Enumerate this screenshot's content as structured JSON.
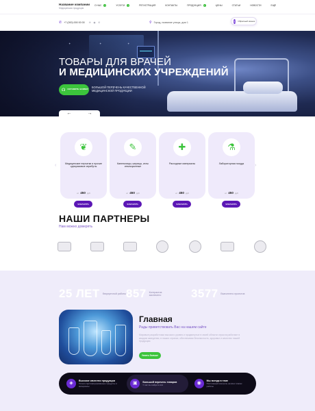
{
  "header": {
    "company_name": "Название компании",
    "company_sub": "Медицинская продукция",
    "nav": [
      {
        "label": "О нас",
        "plus": true
      },
      {
        "label": "Услуги",
        "plus": true
      },
      {
        "label": "Регистрация",
        "plus": false
      },
      {
        "label": "Контакты",
        "plus": false
      },
      {
        "label": "Продукция",
        "plus": true
      },
      {
        "label": "Цены",
        "plus": false
      },
      {
        "label": "Статьи",
        "plus": false
      },
      {
        "label": "Новости",
        "plus": false
      },
      {
        "label": "ЕЩЁ",
        "plus": false
      }
    ],
    "phone": "+7 (000) 000 00 00",
    "socials": "✉ ◉ ✆",
    "address": "Город, название улицы, дом 1",
    "callback_label": "Обратный звонок"
  },
  "hero": {
    "line1": "ТОВАРЫ ДЛЯ ВРАЧЕЙ",
    "line2": "И МЕДИЦИНСКИХ УЧРЕЖДЕНИЙ",
    "cta_label": "Оставить заявку",
    "tagline": "Большой перечень качественной медицинской продукции",
    "prev": "←",
    "next": "→"
  },
  "products": {
    "prev": "‹",
    "next": "›",
    "items": [
      {
        "title": "Медицинские перчатки и прочие одноразовые атрибуты",
        "from": "от",
        "price": "450",
        "currency": "руб",
        "order": "Заказать",
        "icon": "❦"
      },
      {
        "title": "Капельницы, шприцы, иглы инъекционные",
        "from": "от",
        "price": "450",
        "currency": "руб",
        "order": "Заказать",
        "icon": "✎"
      },
      {
        "title": "Расходные материалы",
        "from": "от",
        "price": "450",
        "currency": "руб",
        "order": "Заказать",
        "icon": "✚"
      },
      {
        "title": "Лабораторная посуда",
        "from": "от",
        "price": "450",
        "currency": "руб",
        "order": "Заказать",
        "icon": "⚗"
      }
    ]
  },
  "partners": {
    "title": "НАШИ ПАРТНЕРЫ",
    "subtitle": "Нам можно доверять"
  },
  "about": {
    "stats": [
      {
        "num": "25 ЛЕТ",
        "cap": "безупречной работы"
      },
      {
        "num": "857",
        "cap": "Контрактов заключено"
      },
      {
        "num": "3577",
        "cap": "Выполнено проектов"
      }
    ],
    "title": "Главная",
    "subtitle": "Рады приветствовать Вас на нашем сайте",
    "description": "Мировые разработчики высокого уровня и продвинутые в своей области отрасли работают в каждом заведении, в наших странах, обеспечивая безопасность, здоровье и качество нашей продукции.",
    "more_label": "Узнать больше"
  },
  "features": [
    {
      "title": "Высокое качество продукции",
      "desc": "Только сертифицированные продукты и материалы",
      "icon": "◈"
    },
    {
      "title": "Большой перечень товаров",
      "desc": "У нас вы найдете всё",
      "icon": "▣"
    },
    {
      "title": "Мы всегда в теме",
      "desc": "Постоянный контроль на всех этапах работы",
      "icon": "◉"
    }
  ]
}
